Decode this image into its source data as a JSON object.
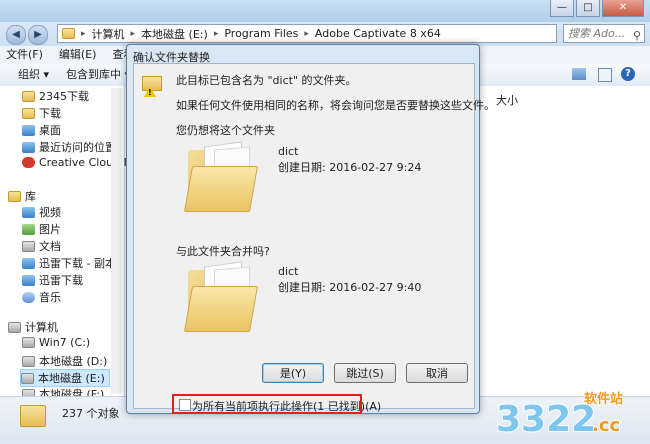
{
  "window": {
    "breadcrumbs": [
      "计算机",
      "本地磁盘 (E:)",
      "Program Files",
      "Adobe Captivate 8 x64"
    ],
    "search_placeholder": "搜索 Ado...",
    "buttons": {
      "minimize": "—",
      "maximize": "□",
      "close": "✕"
    }
  },
  "menubar": [
    "文件(F)",
    "编辑(E)",
    "查看(V)"
  ],
  "toolbar": {
    "organize": "组织 ▾",
    "include_in_library": "包含到库中 ▾"
  },
  "sidebar": {
    "items": [
      {
        "label": "2345下载",
        "icon": "folder-icon"
      },
      {
        "label": "下载",
        "icon": "folder-icon"
      },
      {
        "label": "桌面",
        "icon": "desktop-icon"
      },
      {
        "label": "最近访问的位置",
        "icon": "recent-icon"
      },
      {
        "label": "Creative Cloud F",
        "icon": "creative-cloud-icon"
      }
    ],
    "library_header": "库",
    "library_items": [
      {
        "label": "视频",
        "icon": "video-icon"
      },
      {
        "label": "图片",
        "icon": "picture-icon"
      },
      {
        "label": "文档",
        "icon": "document-icon"
      },
      {
        "label": "迅雷下载 - 副本",
        "icon": "download-icon"
      },
      {
        "label": "迅雷下载",
        "icon": "download-icon"
      },
      {
        "label": "音乐",
        "icon": "music-icon"
      }
    ],
    "computer_header": "计算机",
    "drives": [
      {
        "label": "Win7 (C:)"
      },
      {
        "label": "本地磁盘 (D:)"
      },
      {
        "label": "本地磁盘 (E:)"
      },
      {
        "label": "本地磁盘 (F:)"
      }
    ]
  },
  "content": {
    "column_size": "大小"
  },
  "statusbar": {
    "count": "237 个对象"
  },
  "dialog": {
    "title": "确认文件夹替换",
    "message1": "此目标已包含名为 \"dict\" 的文件夹。",
    "message2": "如果任何文件使用相同的名称，将会询问您是否要替换这些文件。",
    "question1": "您仍想将这个文件夹",
    "source": {
      "name": "dict",
      "date": "创建日期: 2016-02-27 9:24"
    },
    "question2": "与此文件夹合并吗?",
    "target": {
      "name": "dict",
      "date": "创建日期: 2016-02-27 9:40"
    },
    "buttons": {
      "yes": "是(Y)",
      "skip": "跳过(S)",
      "cancel": "取消"
    },
    "checkbox_label": "为所有当前项执行此操作(1 已找到)(A)",
    "checkbox_checked": false
  },
  "watermark": {
    "brand": "3322",
    "suffix": ".cc",
    "caption": "软件站"
  },
  "colors": {
    "accent": "#3c7fb1",
    "highlight": "#e32020",
    "watermark_orange": "#f39a1e"
  }
}
